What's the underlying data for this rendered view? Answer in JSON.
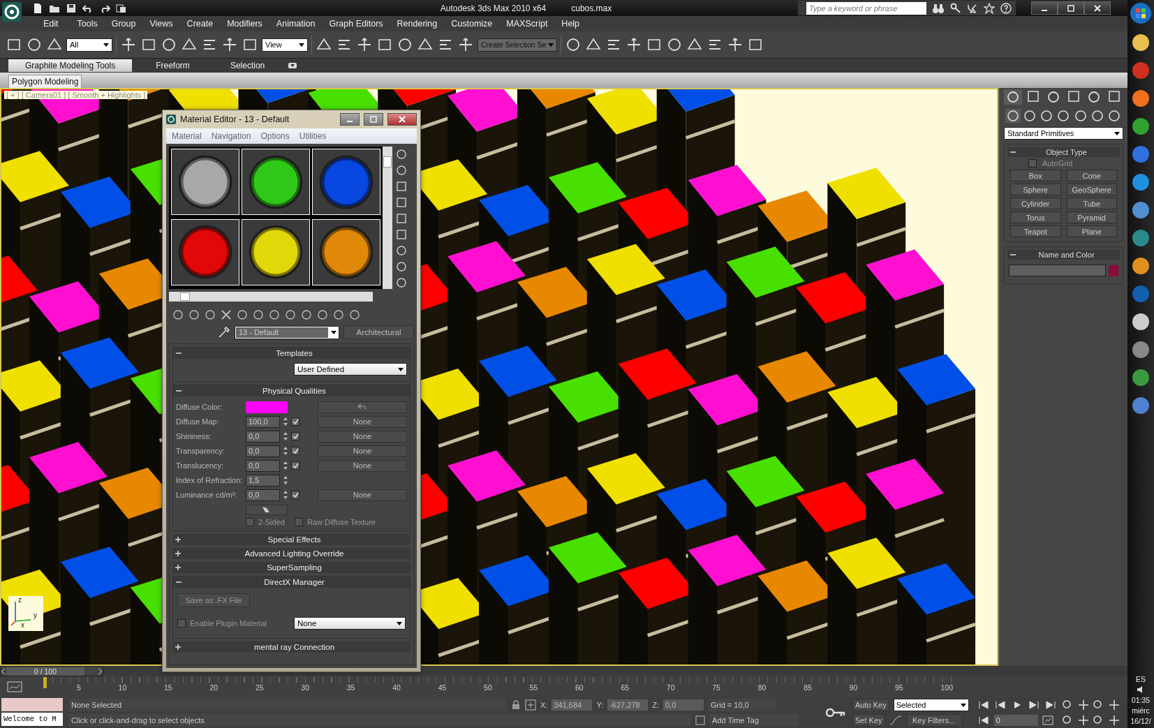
{
  "window": {
    "title": "Autodesk 3ds Max  2010 x64",
    "file": "cubos.max"
  },
  "search": {
    "placeholder": "Type a keyword or phrase"
  },
  "menu": [
    "Edit",
    "Tools",
    "Group",
    "Views",
    "Create",
    "Modifiers",
    "Animation",
    "Graph Editors",
    "Rendering",
    "Customize",
    "MAXScript",
    "Help"
  ],
  "toolbar": {
    "selection_filter": "All",
    "reference_coord": "View",
    "named_selection": "Create Selection Se"
  },
  "ribbon": {
    "tabs": [
      {
        "label": "Graphite Modeling Tools",
        "selected": true
      },
      {
        "label": "Freeform",
        "selected": false
      },
      {
        "label": "Selection",
        "selected": false
      }
    ],
    "panel": "Polygon Modeling"
  },
  "viewport": {
    "label": "[ + ] [ Camera01 ] [ Smooth + Highlights ]",
    "axes": [
      "z",
      "x",
      "y"
    ]
  },
  "material_editor": {
    "title": "Material Editor - 13 - Default",
    "menu": [
      "Material",
      "Navigation",
      "Options",
      "Utilities"
    ],
    "slots": [
      {
        "color": "#a8a8a8"
      },
      {
        "color": "#30c818"
      },
      {
        "color": "#0848e0"
      },
      {
        "color": "#e00808"
      },
      {
        "color": "#e0d808"
      },
      {
        "color": "#e08808"
      }
    ],
    "material_name": "13 - Default",
    "material_type": "Architectural",
    "rollouts": [
      {
        "title": "Templates",
        "kind": "templates",
        "expanded": true,
        "dropdown": "User Defined"
      },
      {
        "title": "Physical Qualities",
        "kind": "physical",
        "expanded": true,
        "rows": [
          {
            "label": "Diffuse Color:",
            "kind": "color",
            "color": "#ff00ff"
          },
          {
            "label": "Diffuse Map:",
            "kind": "spinner",
            "value": "100,0",
            "checked": true,
            "map": "None"
          },
          {
            "label": "Shininess:",
            "kind": "spinner",
            "value": "0,0",
            "checked": true,
            "map": "None"
          },
          {
            "label": "Transparency:",
            "kind": "spinner",
            "value": "0,0",
            "checked": true,
            "map": "None"
          },
          {
            "label": "Translucency:",
            "kind": "spinner",
            "value": "0,0",
            "checked": true,
            "map": "None"
          },
          {
            "label": "Index of Refraction:",
            "kind": "spinner",
            "value": "1,5"
          },
          {
            "label": "Luminance cd/m²:",
            "kind": "spinner",
            "value": "0,0",
            "checked": true,
            "map": "None"
          }
        ],
        "options": [
          {
            "label": "2-Sided",
            "checked": false
          },
          {
            "label": "Raw Diffuse Texture",
            "checked": false
          }
        ]
      },
      {
        "title": "Special Effects",
        "expanded": false
      },
      {
        "title": "Advanced Lighting Override",
        "expanded": false
      },
      {
        "title": "SuperSampling",
        "expanded": false
      },
      {
        "title": "DirectX Manager",
        "kind": "directx",
        "expanded": true,
        "button": "Save as .FX File",
        "option": {
          "label": "Enable Plugin Material",
          "checked": false
        },
        "dropdown": "None"
      },
      {
        "title": "mental ray Connection",
        "expanded": false
      }
    ]
  },
  "command_panel": {
    "category": "Standard Primitives",
    "object_type": {
      "title": "Object Type",
      "autogrid": {
        "label": "AutoGrid",
        "checked": false
      },
      "buttons": [
        "Box",
        "Cone",
        "Sphere",
        "GeoSphere",
        "Cylinder",
        "Tube",
        "Torus",
        "Pyramid",
        "Teapot",
        "Plane"
      ]
    },
    "name_and_color": {
      "title": "Name and Color",
      "color": "#8c0a3c"
    }
  },
  "timeline": {
    "slider": "0 / 100",
    "ticks": [
      "5",
      "10",
      "15",
      "20",
      "25",
      "30",
      "35",
      "40",
      "45",
      "50",
      "55",
      "60",
      "65",
      "70",
      "75",
      "80",
      "85",
      "90",
      "95",
      "100"
    ]
  },
  "status": {
    "listener": "Welcome to M",
    "selection": "None Selected",
    "prompt": "Click or click-and-drag to select objects",
    "coords": [
      {
        "label": "X:",
        "value": "341,684"
      },
      {
        "label": "Y:",
        "value": "-627,278"
      },
      {
        "label": "Z:",
        "value": "0,0"
      }
    ],
    "grid": "Grid = 10,0",
    "time_tag": "Add Time Tag",
    "auto_key": "Auto Key",
    "key_mode": "Selected",
    "set_key": "Set Key",
    "key_filters": "Key Filters...",
    "frame": "0"
  },
  "taskbar": {
    "language": "ES",
    "time": "01:35",
    "day": "miérc",
    "date": "16/12/"
  }
}
